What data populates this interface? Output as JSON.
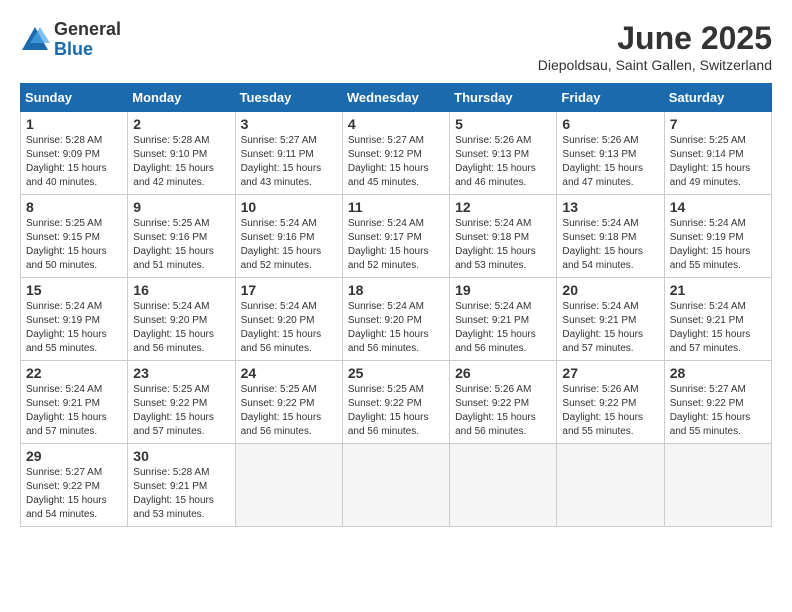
{
  "logo": {
    "general": "General",
    "blue": "Blue"
  },
  "title": "June 2025",
  "location": "Diepoldsau, Saint Gallen, Switzerland",
  "headers": [
    "Sunday",
    "Monday",
    "Tuesday",
    "Wednesday",
    "Thursday",
    "Friday",
    "Saturday"
  ],
  "weeks": [
    [
      {
        "day": "1",
        "sunrise": "5:28 AM",
        "sunset": "9:09 PM",
        "daylight": "15 hours and 40 minutes."
      },
      {
        "day": "2",
        "sunrise": "5:28 AM",
        "sunset": "9:10 PM",
        "daylight": "15 hours and 42 minutes."
      },
      {
        "day": "3",
        "sunrise": "5:27 AM",
        "sunset": "9:11 PM",
        "daylight": "15 hours and 43 minutes."
      },
      {
        "day": "4",
        "sunrise": "5:27 AM",
        "sunset": "9:12 PM",
        "daylight": "15 hours and 45 minutes."
      },
      {
        "day": "5",
        "sunrise": "5:26 AM",
        "sunset": "9:13 PM",
        "daylight": "15 hours and 46 minutes."
      },
      {
        "day": "6",
        "sunrise": "5:26 AM",
        "sunset": "9:13 PM",
        "daylight": "15 hours and 47 minutes."
      },
      {
        "day": "7",
        "sunrise": "5:25 AM",
        "sunset": "9:14 PM",
        "daylight": "15 hours and 49 minutes."
      }
    ],
    [
      {
        "day": "8",
        "sunrise": "5:25 AM",
        "sunset": "9:15 PM",
        "daylight": "15 hours and 50 minutes."
      },
      {
        "day": "9",
        "sunrise": "5:25 AM",
        "sunset": "9:16 PM",
        "daylight": "15 hours and 51 minutes."
      },
      {
        "day": "10",
        "sunrise": "5:24 AM",
        "sunset": "9:16 PM",
        "daylight": "15 hours and 52 minutes."
      },
      {
        "day": "11",
        "sunrise": "5:24 AM",
        "sunset": "9:17 PM",
        "daylight": "15 hours and 52 minutes."
      },
      {
        "day": "12",
        "sunrise": "5:24 AM",
        "sunset": "9:18 PM",
        "daylight": "15 hours and 53 minutes."
      },
      {
        "day": "13",
        "sunrise": "5:24 AM",
        "sunset": "9:18 PM",
        "daylight": "15 hours and 54 minutes."
      },
      {
        "day": "14",
        "sunrise": "5:24 AM",
        "sunset": "9:19 PM",
        "daylight": "15 hours and 55 minutes."
      }
    ],
    [
      {
        "day": "15",
        "sunrise": "5:24 AM",
        "sunset": "9:19 PM",
        "daylight": "15 hours and 55 minutes."
      },
      {
        "day": "16",
        "sunrise": "5:24 AM",
        "sunset": "9:20 PM",
        "daylight": "15 hours and 56 minutes."
      },
      {
        "day": "17",
        "sunrise": "5:24 AM",
        "sunset": "9:20 PM",
        "daylight": "15 hours and 56 minutes."
      },
      {
        "day": "18",
        "sunrise": "5:24 AM",
        "sunset": "9:20 PM",
        "daylight": "15 hours and 56 minutes."
      },
      {
        "day": "19",
        "sunrise": "5:24 AM",
        "sunset": "9:21 PM",
        "daylight": "15 hours and 56 minutes."
      },
      {
        "day": "20",
        "sunrise": "5:24 AM",
        "sunset": "9:21 PM",
        "daylight": "15 hours and 57 minutes."
      },
      {
        "day": "21",
        "sunrise": "5:24 AM",
        "sunset": "9:21 PM",
        "daylight": "15 hours and 57 minutes."
      }
    ],
    [
      {
        "day": "22",
        "sunrise": "5:24 AM",
        "sunset": "9:21 PM",
        "daylight": "15 hours and 57 minutes."
      },
      {
        "day": "23",
        "sunrise": "5:25 AM",
        "sunset": "9:22 PM",
        "daylight": "15 hours and 57 minutes."
      },
      {
        "day": "24",
        "sunrise": "5:25 AM",
        "sunset": "9:22 PM",
        "daylight": "15 hours and 56 minutes."
      },
      {
        "day": "25",
        "sunrise": "5:25 AM",
        "sunset": "9:22 PM",
        "daylight": "15 hours and 56 minutes."
      },
      {
        "day": "26",
        "sunrise": "5:26 AM",
        "sunset": "9:22 PM",
        "daylight": "15 hours and 56 minutes."
      },
      {
        "day": "27",
        "sunrise": "5:26 AM",
        "sunset": "9:22 PM",
        "daylight": "15 hours and 55 minutes."
      },
      {
        "day": "28",
        "sunrise": "5:27 AM",
        "sunset": "9:22 PM",
        "daylight": "15 hours and 55 minutes."
      }
    ],
    [
      {
        "day": "29",
        "sunrise": "5:27 AM",
        "sunset": "9:22 PM",
        "daylight": "15 hours and 54 minutes."
      },
      {
        "day": "30",
        "sunrise": "5:28 AM",
        "sunset": "9:21 PM",
        "daylight": "15 hours and 53 minutes."
      },
      null,
      null,
      null,
      null,
      null
    ]
  ]
}
